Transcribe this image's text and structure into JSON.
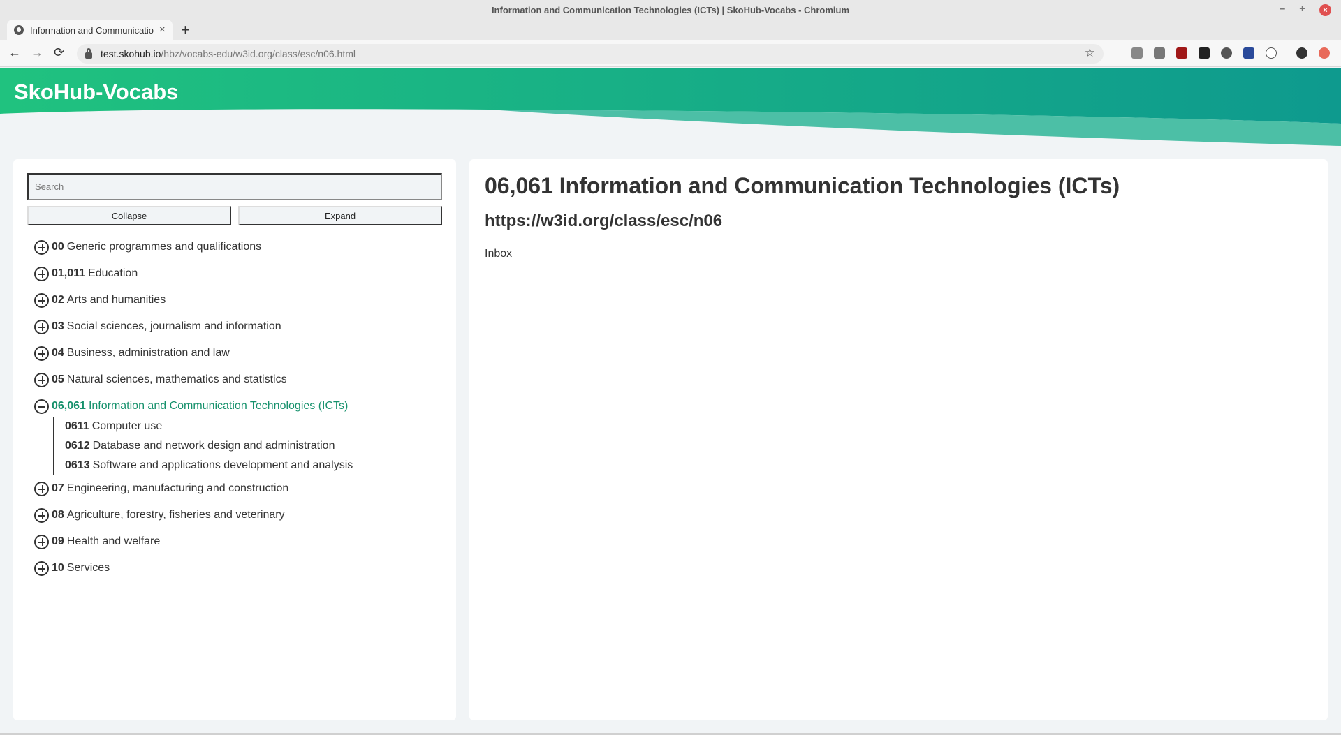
{
  "window": {
    "title": "Information and Communication Technologies (ICTs) | SkoHub-Vocabs - Chromium",
    "controls": [
      "–",
      "+",
      "×"
    ]
  },
  "tab": {
    "title": "Information and Communicatio",
    "close": "×",
    "new_tab": "+"
  },
  "toolbar": {
    "back": "←",
    "forward": "→",
    "reload": "⟳",
    "url_host": "test.skohub.io",
    "url_path": "/hbz/vocabs-edu/w3id.org/class/esc/n06.html",
    "bookmark": "☆"
  },
  "header": {
    "site_title": "SkoHub-Vocabs",
    "colors": {
      "left": "#20c27f",
      "right": "#0e9a8e",
      "wave": "#4cbfa6"
    }
  },
  "sidebar": {
    "search_placeholder": "Search",
    "collapse_label": "Collapse",
    "expand_label": "Expand",
    "tree": [
      {
        "notation": "00",
        "label": "Generic programmes and qualifications",
        "expanded": false
      },
      {
        "notation": "01,011",
        "label": "Education",
        "expanded": false
      },
      {
        "notation": "02",
        "label": "Arts and humanities",
        "expanded": false
      },
      {
        "notation": "03",
        "label": "Social sciences, journalism and information",
        "expanded": false
      },
      {
        "notation": "04",
        "label": "Business, administration and law",
        "expanded": false
      },
      {
        "notation": "05",
        "label": "Natural sciences, mathematics and statistics",
        "expanded": false
      },
      {
        "notation": "06,061",
        "label": "Information and Communication Technologies (ICTs)",
        "expanded": true,
        "children": [
          {
            "notation": "0611",
            "label": "Computer use"
          },
          {
            "notation": "0612",
            "label": "Database and network design and administration"
          },
          {
            "notation": "0613",
            "label": "Software and applications development and analysis"
          }
        ]
      },
      {
        "notation": "07",
        "label": "Engineering, manufacturing and construction",
        "expanded": false
      },
      {
        "notation": "08",
        "label": "Agriculture, forestry, fisheries and veterinary",
        "expanded": false
      },
      {
        "notation": "09",
        "label": "Health and welfare",
        "expanded": false
      },
      {
        "notation": "10",
        "label": "Services",
        "expanded": false
      }
    ]
  },
  "main": {
    "title": "06,061 Information and Communication Technologies (ICTs)",
    "uri": "https://w3id.org/class/esc/n06",
    "inbox_label": "Inbox"
  },
  "colors": {
    "active_accent": "#16916c",
    "page_bg": "#f1f4f6"
  }
}
